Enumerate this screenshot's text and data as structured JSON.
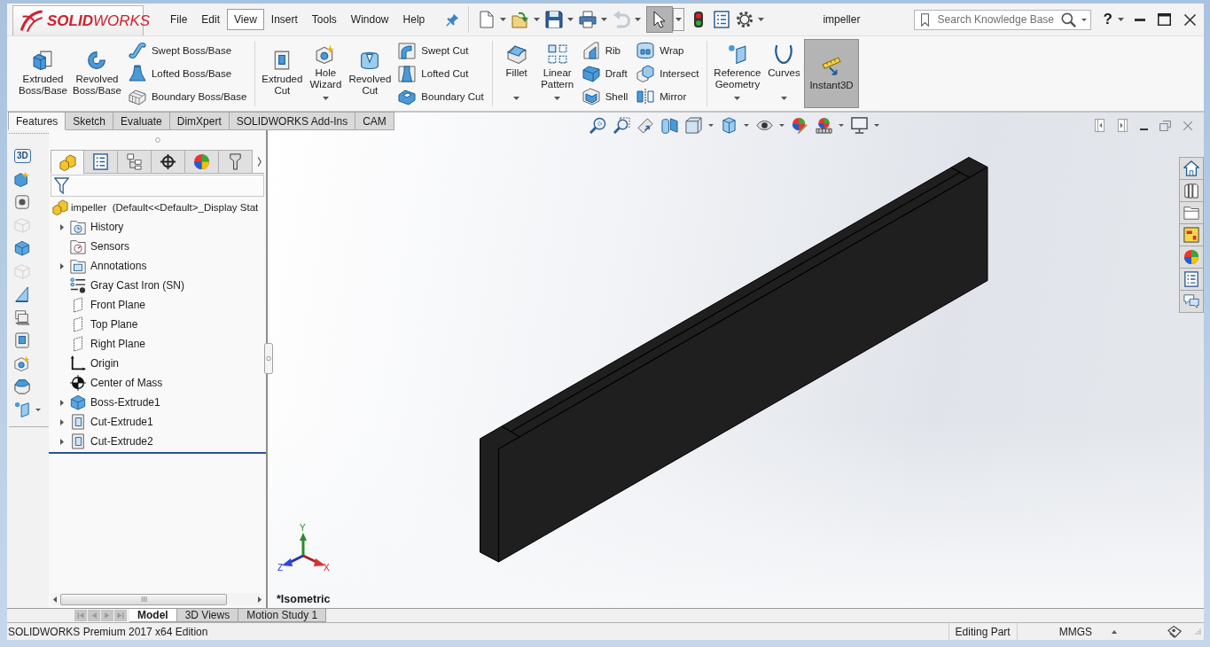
{
  "window": {
    "title": "impeller"
  },
  "logo": {
    "text": "**SOLID**WORKS"
  },
  "menu": [
    {
      "label": "File",
      "selected": false
    },
    {
      "label": "Edit",
      "selected": false
    },
    {
      "label": "View",
      "selected": true
    },
    {
      "label": "Insert",
      "selected": false
    },
    {
      "label": "Tools",
      "selected": false
    },
    {
      "label": "Window",
      "selected": false
    },
    {
      "label": "Help",
      "selected": false
    }
  ],
  "quick_access": [
    {
      "dropdown": true,
      "disabled": false,
      "selected": false
    },
    {
      "dropdown": true,
      "disabled": false,
      "selected": false
    },
    {
      "dropdown": true,
      "disabled": false,
      "selected": false
    },
    {
      "dropdown": true,
      "disabled": false,
      "selected": false
    },
    {
      "dropdown": true,
      "disabled": true,
      "selected": false
    },
    {
      "dropdown": true,
      "disabled": false,
      "selected": true
    },
    {
      "dropdown": false,
      "disabled": false,
      "selected": false
    },
    {
      "dropdown": false,
      "disabled": false,
      "selected": false
    },
    {
      "dropdown": true,
      "disabled": false,
      "selected": false
    }
  ],
  "search": {
    "placeholder": "Search Knowledge Base"
  },
  "help": {
    "label": "?"
  },
  "ribbon": {
    "groups": [
      {
        "items": [
          {
            "kind": "large",
            "label": "Extruded Boss/Base",
            "dropdown": false,
            "pressed": false
          },
          {
            "kind": "large",
            "label": "Revolved Boss/Base",
            "dropdown": false,
            "pressed": false
          },
          {
            "kind": "stack",
            "items": [
              {
                "label": "Swept Boss/Base"
              },
              {
                "label": "Lofted Boss/Base"
              },
              {
                "label": "Boundary Boss/Base"
              }
            ]
          }
        ]
      },
      {
        "items": [
          {
            "kind": "large",
            "label": "Extruded Cut",
            "dropdown": false,
            "pressed": false
          },
          {
            "kind": "large",
            "label": "Hole Wizard",
            "dropdown": true,
            "pressed": false
          },
          {
            "kind": "large",
            "label": "Revolved Cut",
            "dropdown": false,
            "pressed": false
          },
          {
            "kind": "stack",
            "items": [
              {
                "label": "Swept Cut"
              },
              {
                "label": "Lofted Cut"
              },
              {
                "label": "Boundary Cut"
              }
            ]
          }
        ]
      },
      {
        "items": [
          {
            "kind": "large",
            "label": "Fillet",
            "dropdown": true,
            "pressed": false
          },
          {
            "kind": "large",
            "label": "Linear Pattern",
            "dropdown": true,
            "pressed": false
          },
          {
            "kind": "stack",
            "items": [
              {
                "label": "Rib"
              },
              {
                "label": "Draft"
              },
              {
                "label": "Shell"
              }
            ]
          },
          {
            "kind": "stack",
            "items": [
              {
                "label": "Wrap"
              },
              {
                "label": "Intersect"
              },
              {
                "label": "Mirror"
              }
            ]
          }
        ]
      },
      {
        "items": [
          {
            "kind": "large",
            "label": "Reference Geometry",
            "dropdown": true,
            "pressed": false
          },
          {
            "kind": "large",
            "label": "Curves",
            "dropdown": true,
            "pressed": false
          },
          {
            "kind": "large",
            "label": "Instant3D",
            "dropdown": false,
            "pressed": true
          }
        ]
      }
    ]
  },
  "command_tabs": [
    {
      "label": "Features",
      "selected": true
    },
    {
      "label": "Sketch",
      "selected": false
    },
    {
      "label": "Evaluate",
      "selected": false
    },
    {
      "label": "DimXpert",
      "selected": false
    },
    {
      "label": "SOLIDWORKS Add-Ins",
      "selected": false
    },
    {
      "label": "CAM",
      "selected": false
    }
  ],
  "side_toolbar": [
    {
      "label": "3D",
      "disabled": false,
      "dropdown": false
    },
    {
      "disabled": false,
      "dropdown": false
    },
    {
      "disabled": false,
      "dropdown": false
    },
    {
      "disabled": true,
      "dropdown": false
    },
    {
      "disabled": false,
      "dropdown": false
    },
    {
      "disabled": true,
      "dropdown": false
    },
    {
      "disabled": false,
      "dropdown": false
    },
    {
      "disabled": false,
      "dropdown": false
    },
    {
      "disabled": false,
      "dropdown": false
    },
    {
      "disabled": false,
      "dropdown": false
    },
    {
      "disabled": false,
      "dropdown": false
    },
    {
      "disabled": false,
      "dropdown": true
    }
  ],
  "feature_manager": {
    "tabs": [
      {
        "selected": true
      },
      {
        "selected": false
      },
      {
        "selected": false
      },
      {
        "selected": false
      },
      {
        "selected": false
      },
      {
        "selected": false
      }
    ],
    "tree": {
      "label": "impeller  (Default<<Default>_Display Stat",
      "children": [
        {
          "kind": "history",
          "label": "History",
          "expandable": true
        },
        {
          "kind": "sensors",
          "label": "Sensors",
          "expandable": false
        },
        {
          "kind": "annotations",
          "label": "Annotations",
          "expandable": true
        },
        {
          "kind": "material",
          "label": "Gray Cast Iron (SN)",
          "expandable": false
        },
        {
          "kind": "plane",
          "label": "Front Plane",
          "expandable": false
        },
        {
          "kind": "plane",
          "label": "Top Plane",
          "expandable": false
        },
        {
          "kind": "plane",
          "label": "Right Plane",
          "expandable": false
        },
        {
          "kind": "origin",
          "label": "Origin",
          "expandable": false
        },
        {
          "kind": "center_of_mass",
          "label": "Center of Mass",
          "expandable": false
        },
        {
          "kind": "boss",
          "label": "Boss-Extrude1",
          "expandable": true
        },
        {
          "kind": "cut",
          "label": "Cut-Extrude1",
          "expandable": true
        },
        {
          "kind": "cut",
          "label": "Cut-Extrude2",
          "expandable": true
        }
      ]
    }
  },
  "graphics_area": {
    "heads_up_toolbar": [
      {
        "dropdown": false
      },
      {
        "dropdown": false
      },
      {
        "dropdown": false
      },
      {
        "dropdown": false
      },
      {
        "dropdown": true
      },
      {
        "dropdown": true
      },
      {
        "dropdown": true
      },
      {
        "dropdown": false
      },
      {
        "dropdown": true
      },
      {
        "dropdown": true
      }
    ],
    "triad": {
      "x": "X",
      "y": "Y",
      "z": "Z"
    },
    "view_name": "*Isometric"
  },
  "bottom_tabs": [
    {
      "label": "Model",
      "selected": true
    },
    {
      "label": "3D Views",
      "selected": false
    },
    {
      "label": "Motion Study 1",
      "selected": false
    }
  ],
  "status_bar": {
    "edition": "SOLIDWORKS Premium 2017 x64 Edition",
    "mode": "Editing Part",
    "units": "MMGS"
  }
}
